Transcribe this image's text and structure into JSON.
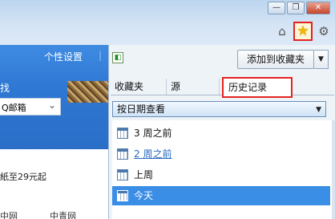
{
  "window": {
    "controls": {
      "minimize": "—",
      "restore": "❐",
      "close": "✕"
    },
    "command_icons": {
      "home": "⌂",
      "favorites": "★",
      "tools": "⚙"
    }
  },
  "background_page": {
    "settings_link": "个性设置",
    "separator": "|",
    "partial_text": "找",
    "mail_select": {
      "value": "Q邮箱",
      "arrow": "⌄"
    },
    "promo": "紙至29元起",
    "footer_left": "中网",
    "footer_right": "中青网"
  },
  "favorites_panel": {
    "pin": "◧",
    "add_button": "添加到收藏夹",
    "add_arrow": "▼",
    "tabs": [
      {
        "label": "收藏夹"
      },
      {
        "label": "源"
      },
      {
        "label": "历史记录"
      }
    ],
    "view_by": {
      "value": "按日期查看",
      "arrow": "▼"
    },
    "history": [
      {
        "label": "3 周之前"
      },
      {
        "label": "2 周之前"
      },
      {
        "label": "上周"
      },
      {
        "label": "今天"
      }
    ]
  },
  "colors": {
    "accent_red": "#e32320",
    "selection": "#3a8ee6",
    "link": "#2a68c0",
    "star": "#f2b600"
  }
}
